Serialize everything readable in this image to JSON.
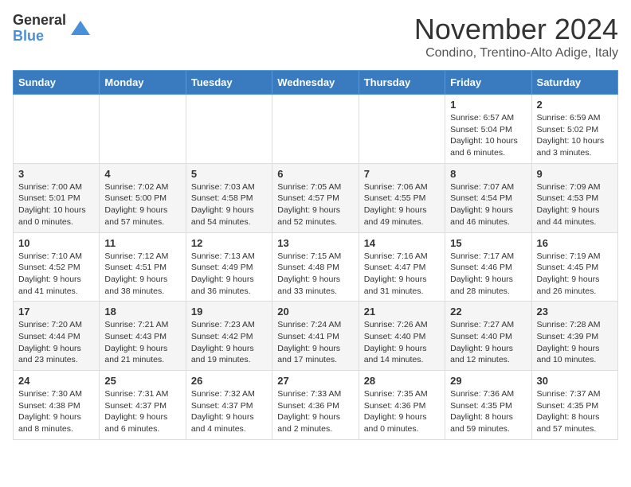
{
  "header": {
    "logo_general": "General",
    "logo_blue": "Blue",
    "month_title": "November 2024",
    "subtitle": "Condino, Trentino-Alto Adige, Italy"
  },
  "days_of_week": [
    "Sunday",
    "Monday",
    "Tuesday",
    "Wednesday",
    "Thursday",
    "Friday",
    "Saturday"
  ],
  "weeks": [
    [
      {
        "day": "",
        "info": ""
      },
      {
        "day": "",
        "info": ""
      },
      {
        "day": "",
        "info": ""
      },
      {
        "day": "",
        "info": ""
      },
      {
        "day": "",
        "info": ""
      },
      {
        "day": "1",
        "info": "Sunrise: 6:57 AM\nSunset: 5:04 PM\nDaylight: 10 hours and 6 minutes."
      },
      {
        "day": "2",
        "info": "Sunrise: 6:59 AM\nSunset: 5:02 PM\nDaylight: 10 hours and 3 minutes."
      }
    ],
    [
      {
        "day": "3",
        "info": "Sunrise: 7:00 AM\nSunset: 5:01 PM\nDaylight: 10 hours and 0 minutes."
      },
      {
        "day": "4",
        "info": "Sunrise: 7:02 AM\nSunset: 5:00 PM\nDaylight: 9 hours and 57 minutes."
      },
      {
        "day": "5",
        "info": "Sunrise: 7:03 AM\nSunset: 4:58 PM\nDaylight: 9 hours and 54 minutes."
      },
      {
        "day": "6",
        "info": "Sunrise: 7:05 AM\nSunset: 4:57 PM\nDaylight: 9 hours and 52 minutes."
      },
      {
        "day": "7",
        "info": "Sunrise: 7:06 AM\nSunset: 4:55 PM\nDaylight: 9 hours and 49 minutes."
      },
      {
        "day": "8",
        "info": "Sunrise: 7:07 AM\nSunset: 4:54 PM\nDaylight: 9 hours and 46 minutes."
      },
      {
        "day": "9",
        "info": "Sunrise: 7:09 AM\nSunset: 4:53 PM\nDaylight: 9 hours and 44 minutes."
      }
    ],
    [
      {
        "day": "10",
        "info": "Sunrise: 7:10 AM\nSunset: 4:52 PM\nDaylight: 9 hours and 41 minutes."
      },
      {
        "day": "11",
        "info": "Sunrise: 7:12 AM\nSunset: 4:51 PM\nDaylight: 9 hours and 38 minutes."
      },
      {
        "day": "12",
        "info": "Sunrise: 7:13 AM\nSunset: 4:49 PM\nDaylight: 9 hours and 36 minutes."
      },
      {
        "day": "13",
        "info": "Sunrise: 7:15 AM\nSunset: 4:48 PM\nDaylight: 9 hours and 33 minutes."
      },
      {
        "day": "14",
        "info": "Sunrise: 7:16 AM\nSunset: 4:47 PM\nDaylight: 9 hours and 31 minutes."
      },
      {
        "day": "15",
        "info": "Sunrise: 7:17 AM\nSunset: 4:46 PM\nDaylight: 9 hours and 28 minutes."
      },
      {
        "day": "16",
        "info": "Sunrise: 7:19 AM\nSunset: 4:45 PM\nDaylight: 9 hours and 26 minutes."
      }
    ],
    [
      {
        "day": "17",
        "info": "Sunrise: 7:20 AM\nSunset: 4:44 PM\nDaylight: 9 hours and 23 minutes."
      },
      {
        "day": "18",
        "info": "Sunrise: 7:21 AM\nSunset: 4:43 PM\nDaylight: 9 hours and 21 minutes."
      },
      {
        "day": "19",
        "info": "Sunrise: 7:23 AM\nSunset: 4:42 PM\nDaylight: 9 hours and 19 minutes."
      },
      {
        "day": "20",
        "info": "Sunrise: 7:24 AM\nSunset: 4:41 PM\nDaylight: 9 hours and 17 minutes."
      },
      {
        "day": "21",
        "info": "Sunrise: 7:26 AM\nSunset: 4:40 PM\nDaylight: 9 hours and 14 minutes."
      },
      {
        "day": "22",
        "info": "Sunrise: 7:27 AM\nSunset: 4:40 PM\nDaylight: 9 hours and 12 minutes."
      },
      {
        "day": "23",
        "info": "Sunrise: 7:28 AM\nSunset: 4:39 PM\nDaylight: 9 hours and 10 minutes."
      }
    ],
    [
      {
        "day": "24",
        "info": "Sunrise: 7:30 AM\nSunset: 4:38 PM\nDaylight: 9 hours and 8 minutes."
      },
      {
        "day": "25",
        "info": "Sunrise: 7:31 AM\nSunset: 4:37 PM\nDaylight: 9 hours and 6 minutes."
      },
      {
        "day": "26",
        "info": "Sunrise: 7:32 AM\nSunset: 4:37 PM\nDaylight: 9 hours and 4 minutes."
      },
      {
        "day": "27",
        "info": "Sunrise: 7:33 AM\nSunset: 4:36 PM\nDaylight: 9 hours and 2 minutes."
      },
      {
        "day": "28",
        "info": "Sunrise: 7:35 AM\nSunset: 4:36 PM\nDaylight: 9 hours and 0 minutes."
      },
      {
        "day": "29",
        "info": "Sunrise: 7:36 AM\nSunset: 4:35 PM\nDaylight: 8 hours and 59 minutes."
      },
      {
        "day": "30",
        "info": "Sunrise: 7:37 AM\nSunset: 4:35 PM\nDaylight: 8 hours and 57 minutes."
      }
    ]
  ]
}
